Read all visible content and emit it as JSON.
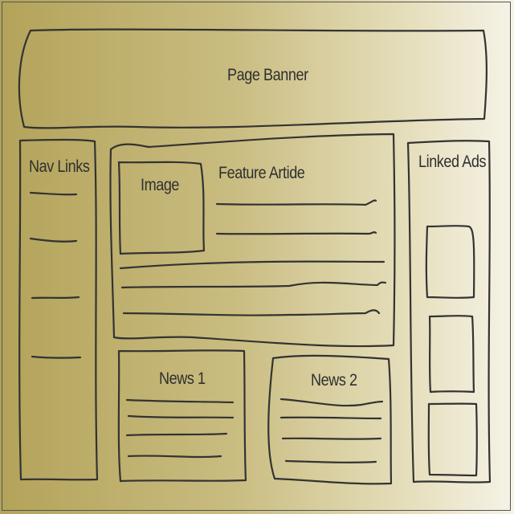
{
  "banner": {
    "label": "Page Banner"
  },
  "nav": {
    "label": "Nav Links",
    "link_count": 4
  },
  "feature": {
    "label": "Feature Artide",
    "image_label": "Image",
    "text_line_count": 5
  },
  "ads": {
    "label": "Linked Ads",
    "ad_count": 3
  },
  "news": [
    {
      "label": "News 1",
      "text_line_count": 4
    },
    {
      "label": "News 2",
      "text_line_count": 4
    }
  ],
  "colors": {
    "ink": "#333333",
    "background_left": "#b3a35a",
    "background_right": "#f6f3e7"
  }
}
